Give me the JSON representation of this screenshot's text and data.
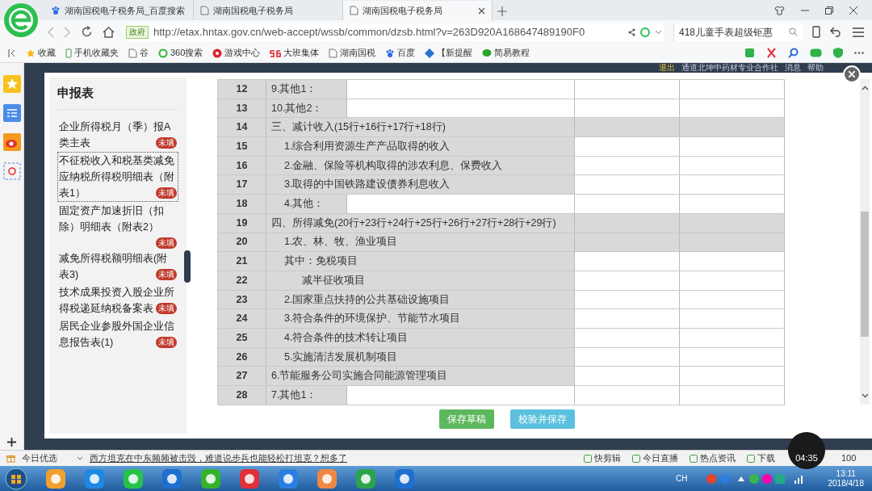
{
  "browser": {
    "tabs": [
      {
        "title": "湖南国税电子税务局_百度搜索",
        "selected": false
      },
      {
        "title": "湖南国税电子税务局",
        "selected": false
      },
      {
        "title": "湖南国税电子税务局",
        "selected": true
      }
    ],
    "address": {
      "badge": "政府",
      "url": "http://etax.hntax.gov.cn/web-accept/wssb/common/dzsb.html?v=263D920A168647489190F0",
      "search": "418儿童手表超级钜惠"
    },
    "bookmarks": [
      "收藏",
      "手机收藏夹",
      "谷",
      "360搜索",
      "游戏中心",
      "大班集体",
      "湖南国税",
      "百度",
      "【新提醒",
      "简易教程"
    ]
  },
  "site_header": {
    "logout": "退出",
    "company": "通道北坤中药材专业合作社",
    "messages": "消息",
    "help": "帮助"
  },
  "sidebar": {
    "title": "申报表",
    "items": [
      {
        "label": "企业所得税月（季）报A类主表",
        "badge": "未填",
        "selected": false
      },
      {
        "label": "不征税收入和税基类减免应纳税所得税明细表（附表1）",
        "badge": "未填",
        "selected": true
      },
      {
        "label": "固定资产加速折旧（扣除）明细表（附表2）",
        "badge": "未填",
        "selected": false
      },
      {
        "label": "减免所得税额明细表(附表3)",
        "badge": "未填",
        "selected": false
      },
      {
        "label": "技术成果投资入股企业所得税递延纳税备案表",
        "badge": "未填",
        "selected": false
      },
      {
        "label": "居民企业参股外国企业信息报告表(1)",
        "badge": "未填",
        "selected": false
      }
    ]
  },
  "table": {
    "rows": [
      {
        "no": "12",
        "label": "9.其他1：",
        "kind": "input",
        "locked": false
      },
      {
        "no": "13",
        "label": "10.其他2：",
        "kind": "input",
        "locked": false
      },
      {
        "no": "14",
        "label": "三、减计收入(15行+16行+17行+18行)",
        "kind": "heading",
        "locked": true
      },
      {
        "no": "15",
        "label": "1.综合利用资源生产产品取得的收入",
        "kind": "item",
        "locked": false
      },
      {
        "no": "16",
        "label": "2.金融、保险等机构取得的涉农利息、保费收入",
        "kind": "item",
        "locked": false
      },
      {
        "no": "17",
        "label": "3.取得的中国铁路建设债券利息收入",
        "kind": "item",
        "locked": false
      },
      {
        "no": "18",
        "label": "4.其他：",
        "kind": "item_input",
        "locked": false
      },
      {
        "no": "19",
        "label": "四、所得减免(20行+23行+24行+25行+26行+27行+28行+29行)",
        "kind": "heading",
        "locked": true
      },
      {
        "no": "20",
        "label": "1.农、林、牧、渔业项目",
        "kind": "item",
        "locked": true
      },
      {
        "no": "21",
        "label": "其中：免税项目",
        "kind": "item",
        "locked": false
      },
      {
        "no": "22",
        "label": "减半征收项目",
        "kind": "subitem",
        "locked": false
      },
      {
        "no": "23",
        "label": "2.国家重点扶持的公共基础设施项目",
        "kind": "item",
        "locked": false
      },
      {
        "no": "24",
        "label": "3.符合条件的环境保护、节能节水项目",
        "kind": "item",
        "locked": false
      },
      {
        "no": "25",
        "label": "4.符合条件的技术转让项目",
        "kind": "item",
        "locked": false
      },
      {
        "no": "26",
        "label": "5.实施清洁发展机制项目",
        "kind": "item",
        "locked": false
      },
      {
        "no": "27",
        "label": "6.节能服务公司实施合同能源管理项目",
        "kind": "heading",
        "locked": false
      },
      {
        "no": "28",
        "label": "7.其他1：",
        "kind": "input",
        "locked": false
      }
    ]
  },
  "buttons": [
    {
      "label": "保存草稿",
      "kind": "primary"
    },
    {
      "label": "校验并保存",
      "kind": "secondary"
    }
  ],
  "status_bar": {
    "today": "今日优选",
    "news": "西方坦克在中东频频被击毁，难道说步兵也能轻松打坦克？想多了",
    "items": [
      "快剪辑",
      "今日直播",
      "热点资讯",
      "下载"
    ],
    "zoom": "100"
  },
  "video_timer": "04:35",
  "taskbar": {
    "lang": "CH",
    "time": "13:11",
    "date": "2018/4/18"
  }
}
